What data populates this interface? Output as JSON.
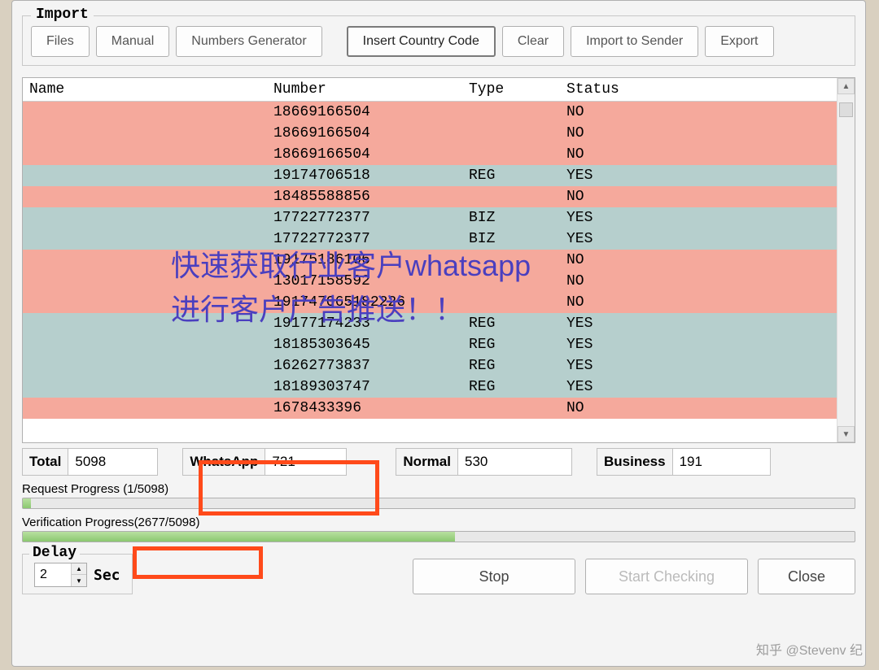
{
  "fieldset_title": "Import",
  "toolbar": {
    "files": "Files",
    "manual": "Manual",
    "numgen": "Numbers Generator",
    "insert_cc": "Insert Country Code",
    "clear": "Clear",
    "import_sender": "Import to Sender",
    "export": "Export"
  },
  "table": {
    "headers": {
      "name": "Name",
      "number": "Number",
      "type": "Type",
      "status": "Status"
    },
    "rows": [
      {
        "name": "",
        "number": "18669166504",
        "type": "",
        "status": "NO",
        "cls": "no"
      },
      {
        "name": "",
        "number": "18669166504",
        "type": "",
        "status": "NO",
        "cls": "no"
      },
      {
        "name": "",
        "number": "18669166504",
        "type": "",
        "status": "NO",
        "cls": "no"
      },
      {
        "name": "",
        "number": "19174706518",
        "type": "REG",
        "status": "YES",
        "cls": "yes"
      },
      {
        "name": "",
        "number": "18485588856",
        "type": "",
        "status": "NO",
        "cls": "no"
      },
      {
        "name": "",
        "number": "17722772377",
        "type": "BIZ",
        "status": "YES",
        "cls": "yes"
      },
      {
        "name": "",
        "number": "17722772377",
        "type": "BIZ",
        "status": "YES",
        "cls": "yes"
      },
      {
        "name": "",
        "number": "19175186106",
        "type": "",
        "status": "NO",
        "cls": "no"
      },
      {
        "name": "",
        "number": "13017158592",
        "type": "",
        "status": "NO",
        "cls": "no"
      },
      {
        "name": "",
        "number": "191747065182226",
        "type": "",
        "status": "NO",
        "cls": "no"
      },
      {
        "name": "",
        "number": "19177174233",
        "type": "REG",
        "status": "YES",
        "cls": "yes"
      },
      {
        "name": "",
        "number": "18185303645",
        "type": "REG",
        "status": "YES",
        "cls": "yes"
      },
      {
        "name": "",
        "number": "16262773837",
        "type": "REG",
        "status": "YES",
        "cls": "yes"
      },
      {
        "name": "",
        "number": "18189303747",
        "type": "REG",
        "status": "YES",
        "cls": "yes"
      },
      {
        "name": "",
        "number": "1678433396",
        "type": "",
        "status": "NO",
        "cls": "no"
      }
    ]
  },
  "stats": {
    "total_label": "Total",
    "total_value": "5098",
    "whatsapp_label": "WhatsApp",
    "whatsapp_value": "721",
    "normal_label": "Normal",
    "normal_value": "530",
    "business_label": "Business",
    "business_value": "191"
  },
  "progress": {
    "request_label": "Request Progress (1/5098)",
    "request_pct": 1,
    "verify_label": "Verification Progress(2677/5098)",
    "verify_pct": 52
  },
  "delay": {
    "legend": "Delay",
    "value": "2",
    "unit": "Sec"
  },
  "buttons": {
    "stop": "Stop",
    "start": "Start Checking",
    "close": "Close"
  },
  "overlay": {
    "line1": "快速获取行业客户whatsapp",
    "line2": "进行客户广告推送！！"
  },
  "watermark": "知乎 @Stevenv 纪"
}
